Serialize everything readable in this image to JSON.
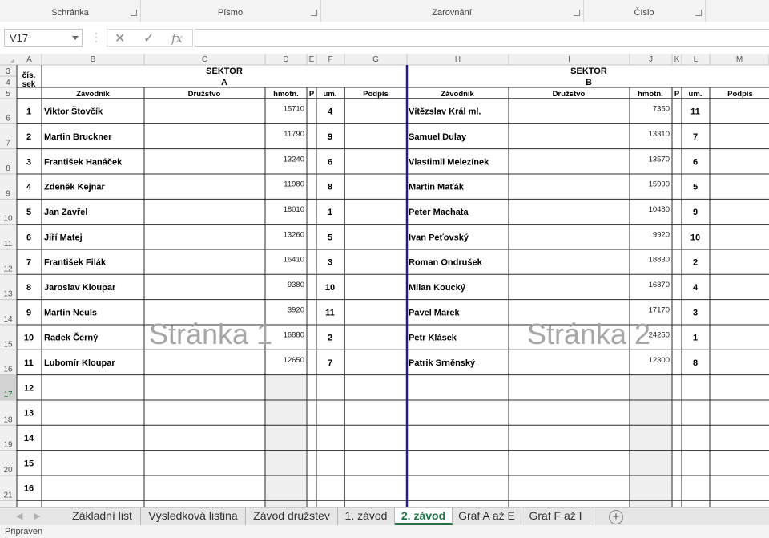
{
  "ribbon": {
    "groups": [
      "Schránka",
      "Písmo",
      "Zarovnání",
      "Číslo"
    ]
  },
  "formula_bar": {
    "name_box": "V17",
    "fx": "fx",
    "value": ""
  },
  "columns": [
    "A",
    "B",
    "C",
    "D",
    "E",
    "F",
    "G",
    "H",
    "I",
    "J",
    "K",
    "L",
    "M"
  ],
  "row_numbers": [
    "3",
    "4",
    "5",
    "6",
    "7",
    "8",
    "9",
    "10",
    "11",
    "12",
    "13",
    "14",
    "15",
    "16",
    "17",
    "18",
    "19",
    "20",
    "21"
  ],
  "selected_row": "17",
  "header": {
    "cis_sek": "čís. sek",
    "sektor": "SEKTOR",
    "sector_a": "A",
    "sector_b": "B",
    "col_labels": {
      "zavodnik": "Závodník",
      "druzstvo": "Družstvo",
      "hmotn": "hmotn.",
      "p": "P",
      "um": "um.",
      "podpis": "Podpis"
    }
  },
  "watermarks": {
    "page1": "Stránka 1",
    "page2": "Stránka 2"
  },
  "rows": [
    {
      "no": "1",
      "a_name": "Viktor Štovčík",
      "a_weight": "15710",
      "a_place": "4",
      "b_name": "Vítězslav Král ml.",
      "b_weight": "7350",
      "b_place": "11"
    },
    {
      "no": "2",
      "a_name": "Martin Bruckner",
      "a_weight": "11790",
      "a_place": "9",
      "b_name": "Samuel Dulay",
      "b_weight": "13310",
      "b_place": "7"
    },
    {
      "no": "3",
      "a_name": "František Hanáček",
      "a_weight": "13240",
      "a_place": "6",
      "b_name": "Vlastimil Melezínek",
      "b_weight": "13570",
      "b_place": "6"
    },
    {
      "no": "4",
      "a_name": "Zdeněk Kejnar",
      "a_weight": "11980",
      "a_place": "8",
      "b_name": "Martin Maťák",
      "b_weight": "15990",
      "b_place": "5"
    },
    {
      "no": "5",
      "a_name": "Jan Zavřel",
      "a_weight": "18010",
      "a_place": "1",
      "b_name": "Peter Machata",
      "b_weight": "10480",
      "b_place": "9"
    },
    {
      "no": "6",
      "a_name": "Jiří Matej",
      "a_weight": "13260",
      "a_place": "5",
      "b_name": "Ivan Peťovský",
      "b_weight": "9920",
      "b_place": "10"
    },
    {
      "no": "7",
      "a_name": "František Filák",
      "a_weight": "16410",
      "a_place": "3",
      "b_name": "Roman Ondrušek",
      "b_weight": "18830",
      "b_place": "2"
    },
    {
      "no": "8",
      "a_name": "Jaroslav Kloupar",
      "a_weight": "9380",
      "a_place": "10",
      "b_name": "Milan Koucký",
      "b_weight": "16870",
      "b_place": "4"
    },
    {
      "no": "9",
      "a_name": "Martin Neuls",
      "a_weight": "3920",
      "a_place": "11",
      "b_name": "Pavel Marek",
      "b_weight": "17170",
      "b_place": "3"
    },
    {
      "no": "10",
      "a_name": "Radek Černý",
      "a_weight": "16880",
      "a_place": "2",
      "b_name": "Petr Klásek",
      "b_weight": "24250",
      "b_place": "1"
    },
    {
      "no": "11",
      "a_name": "Lubomír Kloupar",
      "a_weight": "12650",
      "a_place": "7",
      "b_name": "Patrik Srněnský",
      "b_weight": "12300",
      "b_place": "8"
    },
    {
      "no": "12",
      "a_name": "",
      "a_weight": "",
      "a_place": "",
      "b_name": "",
      "b_weight": "",
      "b_place": ""
    },
    {
      "no": "13",
      "a_name": "",
      "a_weight": "",
      "a_place": "",
      "b_name": "",
      "b_weight": "",
      "b_place": ""
    },
    {
      "no": "14",
      "a_name": "",
      "a_weight": "",
      "a_place": "",
      "b_name": "",
      "b_weight": "",
      "b_place": ""
    },
    {
      "no": "15",
      "a_name": "",
      "a_weight": "",
      "a_place": "",
      "b_name": "",
      "b_weight": "",
      "b_place": ""
    },
    {
      "no": "16",
      "a_name": "",
      "a_weight": "",
      "a_place": "",
      "b_name": "",
      "b_weight": "",
      "b_place": ""
    }
  ],
  "sheet_tabs": [
    "Základní list",
    "Výsledková listina",
    "Závod družstev",
    "1. závod",
    "2. závod",
    "Graf A až E",
    "Graf F až I"
  ],
  "active_tab": "2. závod",
  "status": "Připraven",
  "colors": {
    "excel_green": "#217346",
    "page_break": "#1f1f8a",
    "watermark": "#a6a6a6",
    "gridline": "#d4d4d4",
    "header_bg": "#f0f0f0"
  }
}
